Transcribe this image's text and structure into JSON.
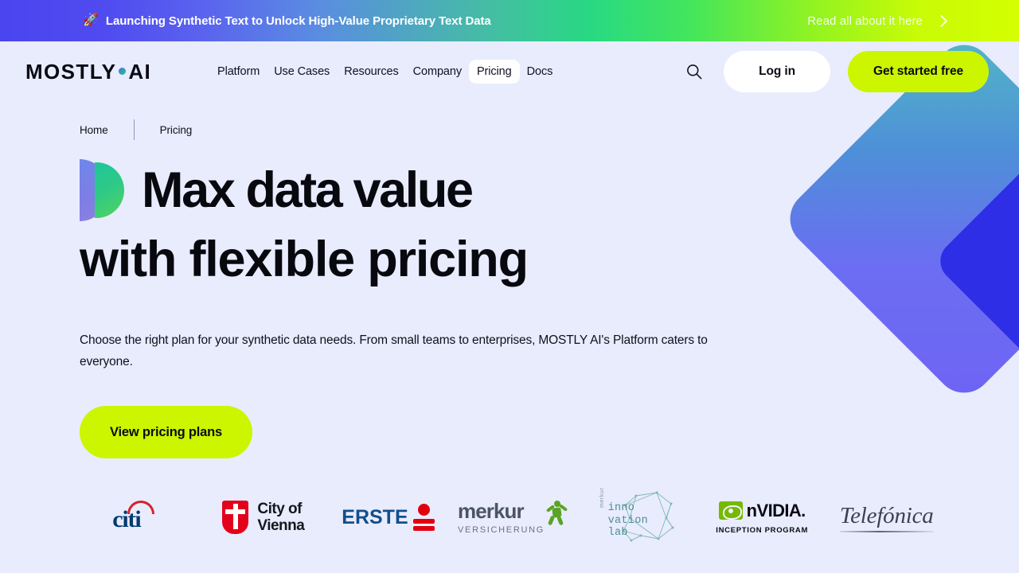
{
  "banner": {
    "rocket_icon": "rocket-icon",
    "message": "Launching Synthetic Text to Unlock High-Value Proprietary Text Data",
    "cta_label": "Read all about it here",
    "cta_icon": "chevron-right-icon",
    "gradient_start": "#4a45ef",
    "gradient_mid": "#27d982",
    "gradient_end": "#d4ff00"
  },
  "nav": {
    "logo_prefix": "MOSTLY",
    "logo_suffix": "AI",
    "logo_dot_icon": "gradient-dot-icon",
    "links": [
      {
        "label": "Platform",
        "active": false
      },
      {
        "label": "Use Cases",
        "active": false
      },
      {
        "label": "Resources",
        "active": false
      },
      {
        "label": "Company",
        "active": false
      },
      {
        "label": "Pricing",
        "active": true
      },
      {
        "label": "Docs",
        "active": false
      }
    ],
    "search_icon": "search-icon",
    "login_label": "Log in",
    "get_started_label": "Get started free",
    "accent_color": "#ccf500",
    "login_bg": "#ffffff"
  },
  "breadcrumb": {
    "items": [
      {
        "label": "Home"
      },
      {
        "label": "Pricing"
      }
    ]
  },
  "hero": {
    "mark_icon": "mostly-ai-d-mark-icon",
    "heading_line1": "Max data value",
    "heading_line2": "with  flexible  pricing",
    "subtext": "Choose the right plan for your synthetic data needs. From small teams to enterprises, MOSTLY AI's Platform caters to everyone.",
    "cta_label": "View pricing plans",
    "cta_color": "#ccf500"
  },
  "decor": {
    "chevron_icon": "chevron-art-icon",
    "outer_gradient_start": "#52b8c6",
    "outer_gradient_end": "#6f63f4",
    "inner_color": "#2d2ee6"
  },
  "clients": {
    "citi": {
      "name": "citi",
      "text": "citi",
      "primary": "#003b70",
      "accent": "#d6232a"
    },
    "vienna": {
      "name": "city-of-vienna",
      "line1": "City of",
      "line2": "Vienna",
      "accent": "#e3001b"
    },
    "erste": {
      "name": "erste",
      "text": "ERSTE",
      "primary": "#114f8c",
      "accent": "#e2000f"
    },
    "merkur": {
      "name": "merkur-versicherung",
      "text": "merkur",
      "sub": "VERSICHERUNG",
      "accent": "#5aa425"
    },
    "innolab": {
      "name": "merkur-innovation-lab",
      "side": "merkur",
      "word1": "inno",
      "word2": "vation",
      "word3": "lab",
      "accent": "#4e8e92"
    },
    "nvidia": {
      "name": "nvidia-inception-program",
      "text": "nVIDIA.",
      "sub": "INCEPTION PROGRAM",
      "accent": "#76b900"
    },
    "telefonica": {
      "name": "telefonica",
      "text": "Telefónica"
    }
  },
  "page": {
    "background": "#e9ecfd"
  }
}
